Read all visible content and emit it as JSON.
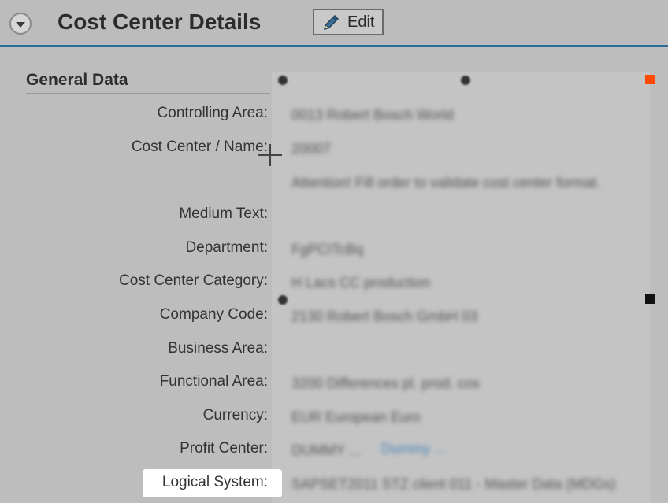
{
  "header": {
    "title": "Cost Center Details",
    "edit_label": "Edit",
    "accent_color": "#2a6c9a"
  },
  "section": {
    "title": "General Data"
  },
  "fields": [
    {
      "label": "Controlling Area:",
      "value": "0013 Robert Bosch World"
    },
    {
      "label": "Cost Center / Name:",
      "value": "20007"
    },
    {
      "label": "",
      "value": "Attention! Fill order to validate cost center format."
    },
    {
      "label": "Medium Text:",
      "value": ""
    },
    {
      "label": "Department:",
      "value": "FgPCITcBq"
    },
    {
      "label": "Cost Center Category:",
      "value": "H Lacs CC production"
    },
    {
      "label": "Company Code:",
      "value": "2130 Robert Bosch GmbH 03"
    },
    {
      "label": "Business Area:",
      "value": ""
    },
    {
      "label": "Functional Area:",
      "value": "3200 Differences pl. prod. cos"
    },
    {
      "label": "Currency:",
      "value": "EUR European Euro"
    },
    {
      "label": "Profit Center:",
      "value": "DUMMY ...",
      "link": "Dummy ..."
    },
    {
      "label": "Logical System:",
      "value": "SAPSET2011 STZ client 011 - Master Data (MDGs)"
    }
  ],
  "markers": {
    "orange_square_color": "#ff4a00",
    "black_square_color": "#111111"
  }
}
